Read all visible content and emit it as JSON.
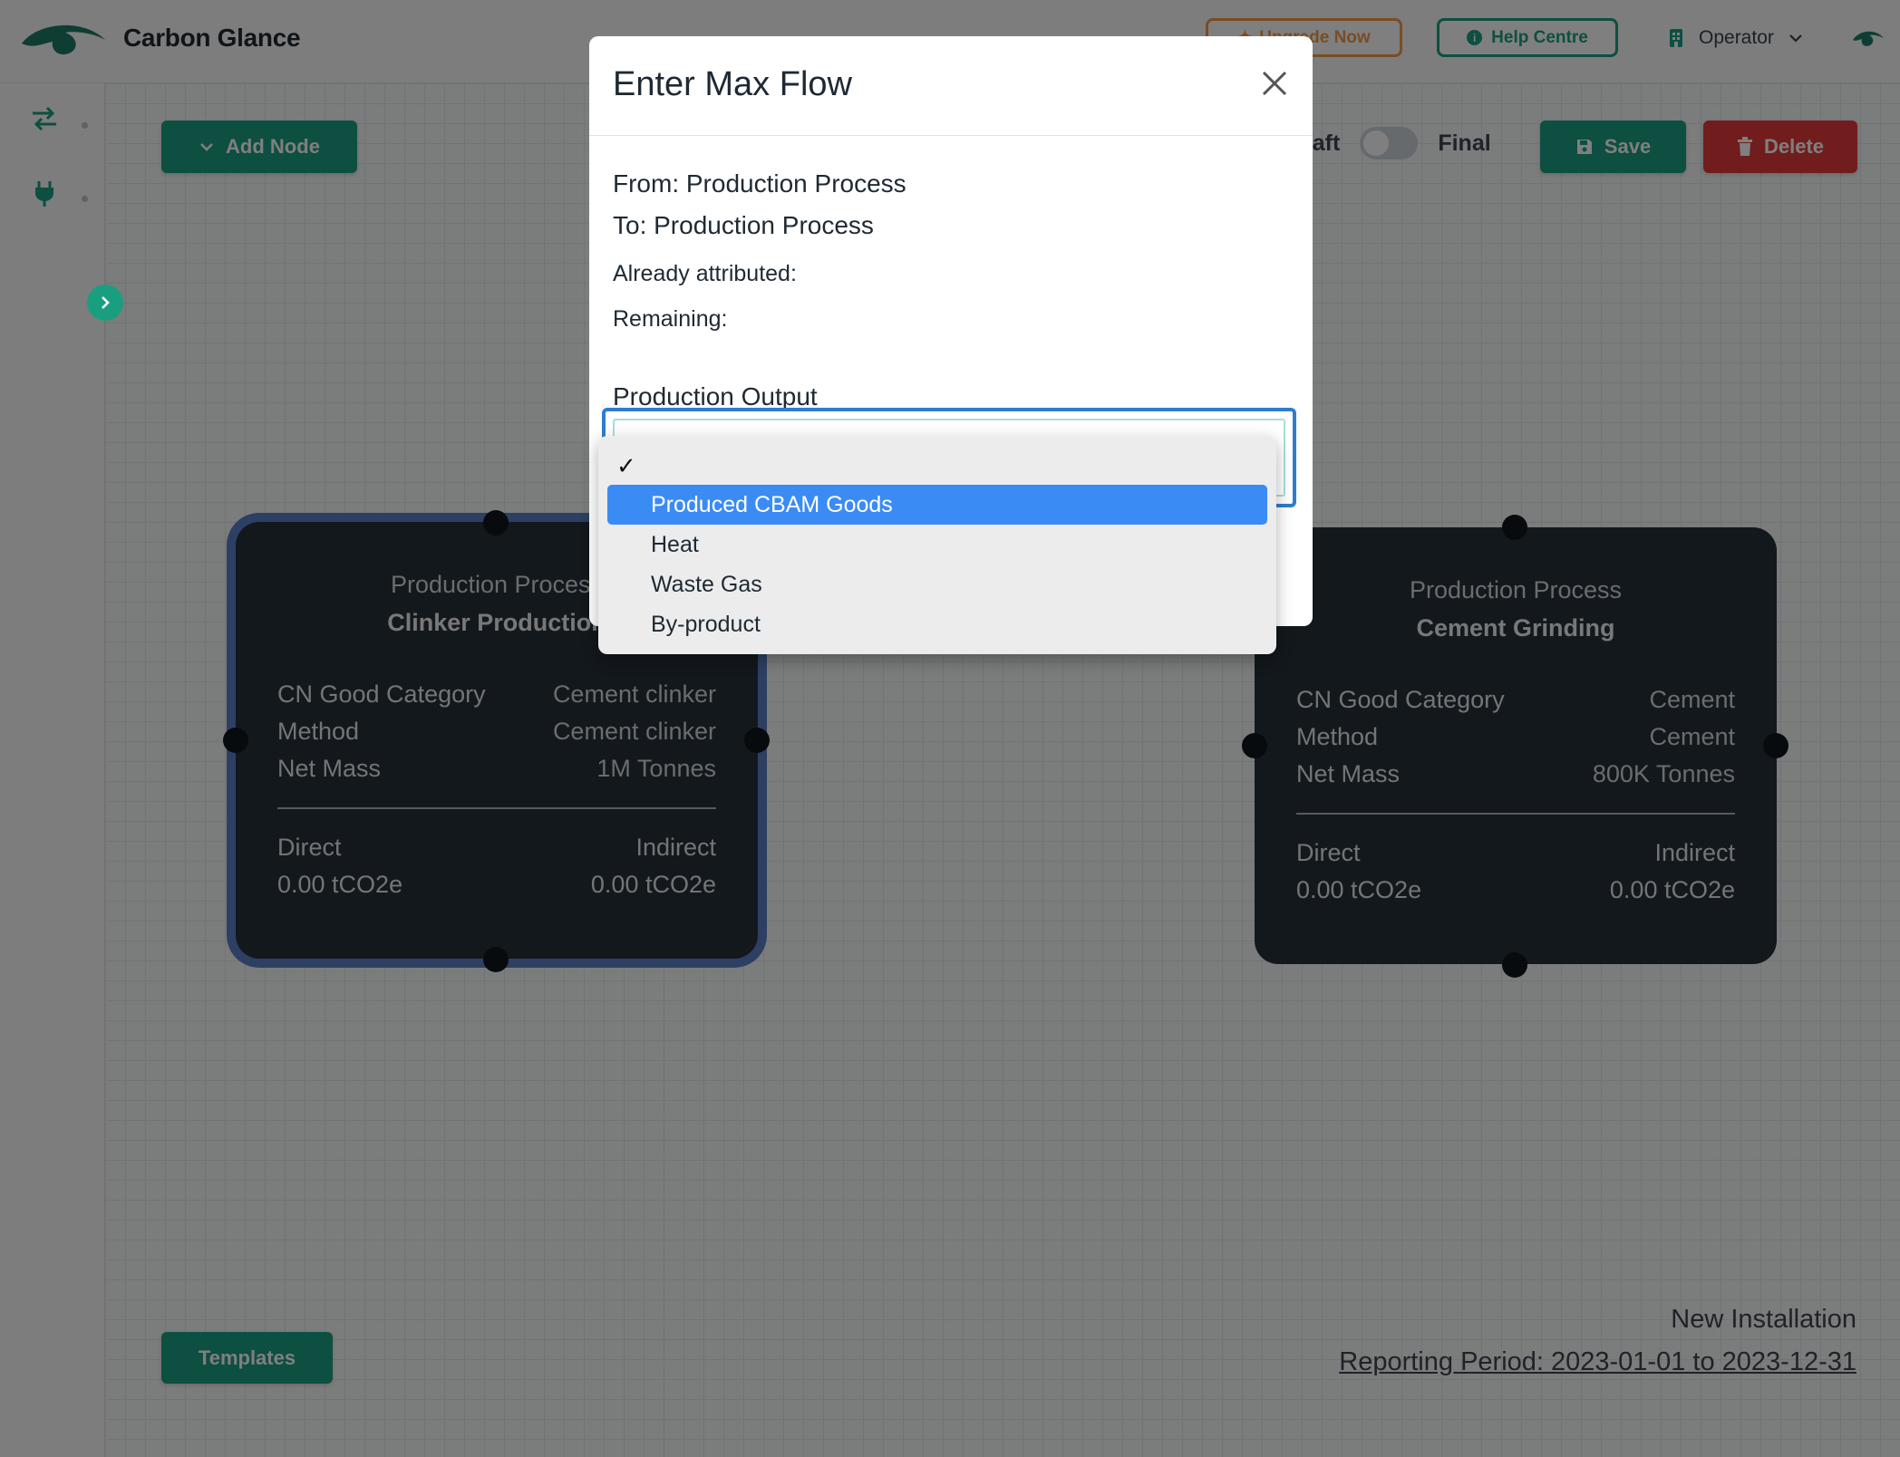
{
  "app": {
    "brand": "Carbon Glance"
  },
  "header": {
    "upgrade_label": "Upgrade Now",
    "help_label": "Help Centre",
    "user_role": "Operator"
  },
  "toolbar": {
    "add_node_label": "Add Node",
    "draft_label": "Draft",
    "final_label": "Final",
    "save_label": "Save",
    "delete_label": "Delete"
  },
  "nodes": [
    {
      "type": "Production Process",
      "name": "Clinker Production",
      "rows": [
        {
          "label": "CN Good Category",
          "value": "Cement clinker"
        },
        {
          "label": "Method",
          "value": "Cement clinker"
        },
        {
          "label": "Net Mass",
          "value": "1M Tonnes"
        }
      ],
      "direct_label": "Direct",
      "direct_value": "0.00 tCO2e",
      "indirect_label": "Indirect",
      "indirect_value": "0.00 tCO2e"
    },
    {
      "type": "Production Process",
      "name": "Cement Grinding",
      "rows": [
        {
          "label": "CN Good Category",
          "value": "Cement"
        },
        {
          "label": "Method",
          "value": "Cement"
        },
        {
          "label": "Net Mass",
          "value": "800K Tonnes"
        }
      ],
      "direct_label": "Direct",
      "direct_value": "0.00 tCO2e",
      "indirect_label": "Indirect",
      "indirect_value": "0.00 tCO2e"
    }
  ],
  "footer": {
    "templates_label": "Templates",
    "installation": "New Installation",
    "reporting_period": "Reporting Period: 2023-01-01 to 2023-12-31"
  },
  "modal": {
    "title": "Enter Max Flow",
    "from": "From: Production Process",
    "to": "To: Production Process",
    "already_attributed": "Already attributed:",
    "remaining": "Remaining:",
    "field_label": "Production Output",
    "options": [
      "Produced CBAM Goods",
      "Heat",
      "Waste Gas",
      "By-product"
    ],
    "highlighted_option": "Produced CBAM Goods"
  },
  "colors": {
    "brand_green": "#1a9e80",
    "upgrade_orange": "#f29b47",
    "delete_red": "#e23b3b",
    "node_bg": "#27313b",
    "selected_outline": "#5b7fc7",
    "dropdown_highlight": "#3b8bf5"
  },
  "icons": {
    "logo": "eye-logo-icon",
    "help": "info-icon",
    "user": "building-icon",
    "add": "chevron-down-icon",
    "save": "floppy-disk-icon",
    "delete": "trash-icon",
    "rail_1": "swap-arrows-icon",
    "rail_2": "plug-icon",
    "close": "close-icon",
    "check": "checkmark-icon"
  }
}
